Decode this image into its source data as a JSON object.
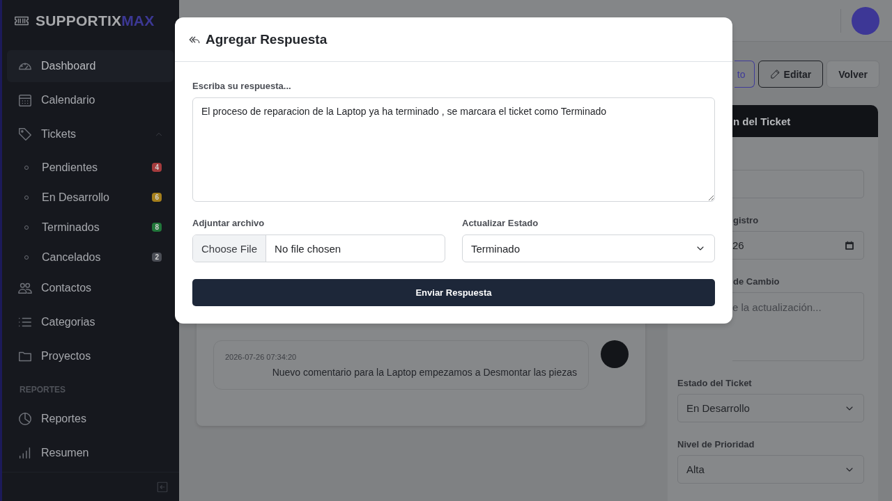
{
  "sidebar": {
    "logo": {
      "text": "SUPPORTIX",
      "accent": "MAX"
    },
    "items": [
      {
        "label": "Dashboard",
        "selected": true
      },
      {
        "label": "Calendario",
        "selected": false
      },
      {
        "label": "Tickets",
        "selected": false,
        "expanded": true,
        "children": [
          {
            "label": "Pendientes",
            "selected": false,
            "badge": "4",
            "color": "#a43b3d"
          },
          {
            "label": "En Desarrollo",
            "selected": false,
            "badge": "6",
            "color": "#a57f1c"
          },
          {
            "label": "Terminados",
            "selected": false,
            "badge": "8",
            "color": "#21763a"
          },
          {
            "label": "Cancelados",
            "selected": false,
            "badge": "2",
            "color": "#4b4e56"
          }
        ]
      },
      {
        "label": "Contactos",
        "selected": false
      },
      {
        "label": "Categorias",
        "selected": false
      },
      {
        "label": "Proyectos",
        "selected": false
      }
    ],
    "section_heading": "REPORTES",
    "report_items": [
      {
        "label": "Reportes",
        "selected": false
      },
      {
        "label": "Resumen",
        "selected": false
      }
    ]
  },
  "page": {
    "actions": [
      {
        "label": "to",
        "kind": "outline-partial"
      },
      {
        "label": "Editar",
        "kind": "outline"
      },
      {
        "label": "Volver",
        "kind": "plain"
      }
    ],
    "comments": [
      {
        "time": "2026-07-26 07:34:20",
        "text": "Nuevo comentario para la Laptop empezamos a Desmontar las piezas"
      }
    ],
    "ticket_panel": {
      "title": "n del Ticket",
      "fields": [
        {
          "kind": "input"
        },
        {
          "kind": "date",
          "label": "gistro",
          "value": "26",
          "partial": true
        },
        {
          "kind": "textarea",
          "label": "de Cambio",
          "placeholder": "e la actualización...",
          "partial": true
        },
        {
          "kind": "select",
          "label": "Estado del Ticket",
          "value": "En Desarrollo",
          "partial": false
        },
        {
          "kind": "select",
          "label": "Nivel de Prioridad",
          "value": "Alta",
          "partial": false
        }
      ]
    }
  },
  "modal": {
    "title": "Agregar Respuesta",
    "answer_label": "Escriba su respuesta...",
    "answer": "El proceso de reparacion de la Laptop ya ha terminado , se marcara el ticket como Terminado",
    "attach_label": "Adjuntar archivo",
    "file_button": "Choose File",
    "file_status": "No file chosen",
    "status_label": "Actualizar Estado",
    "status_value": "Terminado",
    "submit": "Enviar Respuesta"
  }
}
